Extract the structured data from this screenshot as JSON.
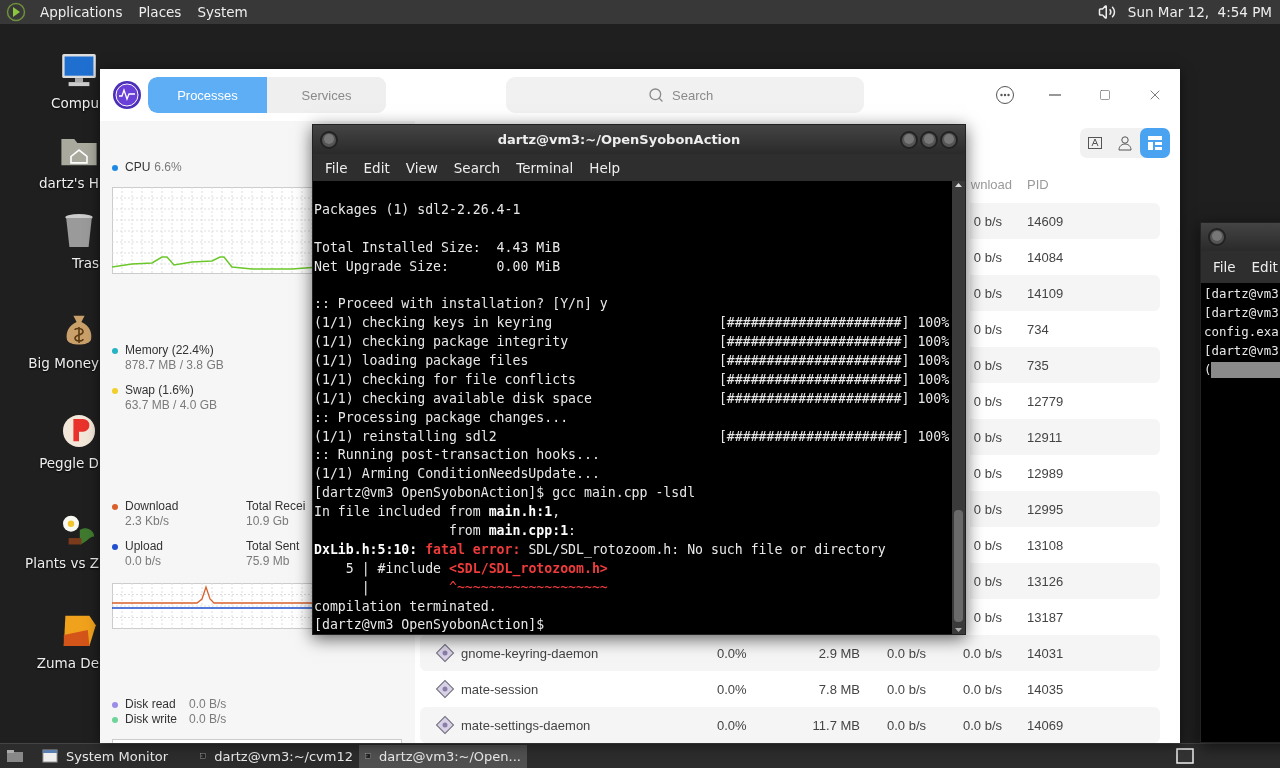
{
  "top_panel": {
    "menus": [
      "Applications",
      "Places",
      "System"
    ],
    "clock": "Sun Mar 12,  4:54 PM"
  },
  "desktop_icons": [
    {
      "label": "Compu",
      "kind": "computer"
    },
    {
      "label": "dartz's H",
      "kind": "home"
    },
    {
      "label": "Tras",
      "kind": "trash"
    },
    {
      "label": "Big Money",
      "kind": "moneybag"
    },
    {
      "label": "Peggle D",
      "kind": "peggle"
    },
    {
      "label": "Plants vs Z",
      "kind": "plants"
    },
    {
      "label": "Zuma De",
      "kind": "zuma"
    }
  ],
  "system_monitor": {
    "tabs": [
      {
        "label": "Processes",
        "selected": true
      },
      {
        "label": "Services",
        "selected": false
      }
    ],
    "search": {
      "placeholder": "Search"
    },
    "sidebar": {
      "cpu": {
        "label": "CPU",
        "value": "6.6%",
        "color": "#1e88e5"
      },
      "memory": [
        {
          "label": "Memory (22.4%)",
          "detail": "878.7 MB / 3.8 GB",
          "color": "#26b3c4"
        },
        {
          "label": "Swap (1.6%)",
          "detail": "63.7 MB / 4.0 GB",
          "color": "#f2cf2b"
        }
      ],
      "network": [
        {
          "label": "Download",
          "value": "2.3 Kb/s",
          "color": "#d9602b",
          "total_label": "Total Recei",
          "total": "10.9 Gb"
        },
        {
          "label": "Upload",
          "value": "0.0 b/s",
          "color": "#1f4fcf",
          "total_label": "Total Sent",
          "total": "75.9 Mb"
        }
      ],
      "disk": [
        {
          "label": "Disk read",
          "value": "0.0 B/s",
          "color": "#9a8ee6"
        },
        {
          "label": "Disk write",
          "value": "0.0 B/s",
          "color": "#6fd39a"
        }
      ]
    },
    "view_buttons": [
      {
        "kind": "text",
        "selected": false
      },
      {
        "kind": "user",
        "selected": false
      },
      {
        "kind": "tree",
        "selected": true
      }
    ],
    "table": {
      "columns": [
        "wnload",
        "PID"
      ],
      "rows": [
        {
          "download": "0 b/s",
          "pid": "14609"
        },
        {
          "download": "0 b/s",
          "pid": "14084"
        },
        {
          "download": "0 b/s",
          "pid": "14109"
        },
        {
          "download": "0 b/s",
          "pid": "734"
        },
        {
          "download": "0 b/s",
          "pid": "735"
        },
        {
          "download": "0 b/s",
          "pid": "12779"
        },
        {
          "download": "0 b/s",
          "pid": "12911"
        },
        {
          "download": "0 b/s",
          "pid": "12989"
        },
        {
          "download": "0 b/s",
          "pid": "12995"
        },
        {
          "download": "0 b/s",
          "pid": "13108"
        },
        {
          "download": "0 b/s",
          "pid": "13126"
        },
        {
          "download": "0 b/s",
          "pid": "13187"
        },
        {
          "name": "gnome-keyring-daemon",
          "cpu": "0.0%",
          "memory": "2.9 MB",
          "upload": "0.0 b/s",
          "download": "0.0 b/s",
          "pid": "14031"
        },
        {
          "name": "mate-session",
          "cpu": "0.0%",
          "memory": "7.8 MB",
          "upload": "0.0 b/s",
          "download": "0.0 b/s",
          "pid": "14035"
        },
        {
          "name": "mate-settings-daemon",
          "cpu": "0.0%",
          "memory": "11.7 MB",
          "upload": "0.0 b/s",
          "download": "0.0 b/s",
          "pid": "14069"
        }
      ]
    }
  },
  "terminal": {
    "title": "dartz@vm3:~/OpenSyobonAction",
    "menus": [
      "File",
      "Edit",
      "View",
      "Search",
      "Terminal",
      "Help"
    ],
    "lines": [
      {
        "kind": "blank"
      },
      {
        "kind": "text",
        "segments": [
          {
            "kind": "plain",
            "text": "Packages (1) sdl2-2.26.4-1"
          }
        ]
      },
      {
        "kind": "blank"
      },
      {
        "kind": "text",
        "segments": [
          {
            "kind": "plain",
            "text": "Total Installed Size:  4.43 MiB"
          }
        ]
      },
      {
        "kind": "text",
        "segments": [
          {
            "kind": "plain",
            "text": "Net Upgrade Size:      0.00 MiB"
          }
        ]
      },
      {
        "kind": "blank"
      },
      {
        "kind": "text",
        "segments": [
          {
            "kind": "plain",
            "text": ":: Proceed with installation? [Y/n] y"
          }
        ]
      },
      {
        "kind": "text",
        "segments": [
          {
            "kind": "plain",
            "text": "(1/1) checking keys in keyring                     [######################] 100%"
          }
        ]
      },
      {
        "kind": "text",
        "segments": [
          {
            "kind": "plain",
            "text": "(1/1) checking package integrity                   [######################] 100%"
          }
        ]
      },
      {
        "kind": "text",
        "segments": [
          {
            "kind": "plain",
            "text": "(1/1) loading package files                        [######################] 100%"
          }
        ]
      },
      {
        "kind": "text",
        "segments": [
          {
            "kind": "plain",
            "text": "(1/1) checking for file conflicts                  [######################] 100%"
          }
        ]
      },
      {
        "kind": "text",
        "segments": [
          {
            "kind": "plain",
            "text": "(1/1) checking available disk space                [######################] 100%"
          }
        ]
      },
      {
        "kind": "text",
        "segments": [
          {
            "kind": "plain",
            "text": ":: Processing package changes..."
          }
        ]
      },
      {
        "kind": "text",
        "segments": [
          {
            "kind": "plain",
            "text": "(1/1) reinstalling sdl2                            [######################] 100%"
          }
        ]
      },
      {
        "kind": "text",
        "segments": [
          {
            "kind": "plain",
            "text": ":: Running post-transaction hooks..."
          }
        ]
      },
      {
        "kind": "text",
        "segments": [
          {
            "kind": "plain",
            "text": "(1/1) Arming ConditionNeedsUpdate..."
          }
        ]
      },
      {
        "kind": "text",
        "segments": [
          {
            "kind": "plain",
            "text": "[dartz@vm3 OpenSyobonAction]$ gcc main.cpp -lsdl"
          }
        ]
      },
      {
        "kind": "text",
        "segments": [
          {
            "kind": "plain",
            "text": "In file included from "
          },
          {
            "kind": "bold",
            "text": "main.h:1"
          },
          {
            "kind": "plain",
            "text": ","
          }
        ]
      },
      {
        "kind": "text",
        "segments": [
          {
            "kind": "plain",
            "text": "                 from "
          },
          {
            "kind": "bold",
            "text": "main.cpp:1"
          },
          {
            "kind": "plain",
            "text": ":"
          }
        ]
      },
      {
        "kind": "text",
        "segments": [
          {
            "kind": "bold",
            "text": "DxLib.h:5:10: "
          },
          {
            "kind": "error",
            "text": "fatal error:"
          },
          {
            "kind": "plain",
            "text": " SDL/SDL_rotozoom.h: No such file or directory"
          }
        ]
      },
      {
        "kind": "text",
        "segments": [
          {
            "kind": "plain",
            "text": "    5 | #include "
          },
          {
            "kind": "error",
            "text": "<SDL/SDL_rotozoom.h>"
          }
        ]
      },
      {
        "kind": "text",
        "segments": [
          {
            "kind": "plain",
            "text": "      |          "
          },
          {
            "kind": "red",
            "text": "^~~~~~~~~~~~~~~~~~~~"
          }
        ]
      },
      {
        "kind": "text",
        "segments": [
          {
            "kind": "plain",
            "text": "compilation terminated."
          }
        ]
      },
      {
        "kind": "text",
        "segments": [
          {
            "kind": "plain",
            "text": "[dartz@vm3 OpenSyobonAction]$"
          }
        ]
      }
    ]
  },
  "terminal_2": {
    "menus": [
      "File",
      "Edit"
    ],
    "lines": [
      {
        "kind": "text",
        "text": "[dartz@vm3"
      },
      {
        "kind": "text",
        "text": "[dartz@vm3"
      },
      {
        "kind": "text",
        "text": "config.exa"
      },
      {
        "kind": "text",
        "text": "[dartz@vm3"
      },
      {
        "kind": "highlight",
        "text": "("
      }
    ]
  },
  "taskbar": {
    "items": [
      {
        "label": "System Monitor",
        "kind": "window",
        "selected": false
      },
      {
        "label": "dartz@vm3:~/cvm12",
        "kind": "terminal",
        "selected": false
      },
      {
        "label": "dartz@vm3:~/Open...",
        "kind": "terminal",
        "selected": true
      }
    ]
  }
}
